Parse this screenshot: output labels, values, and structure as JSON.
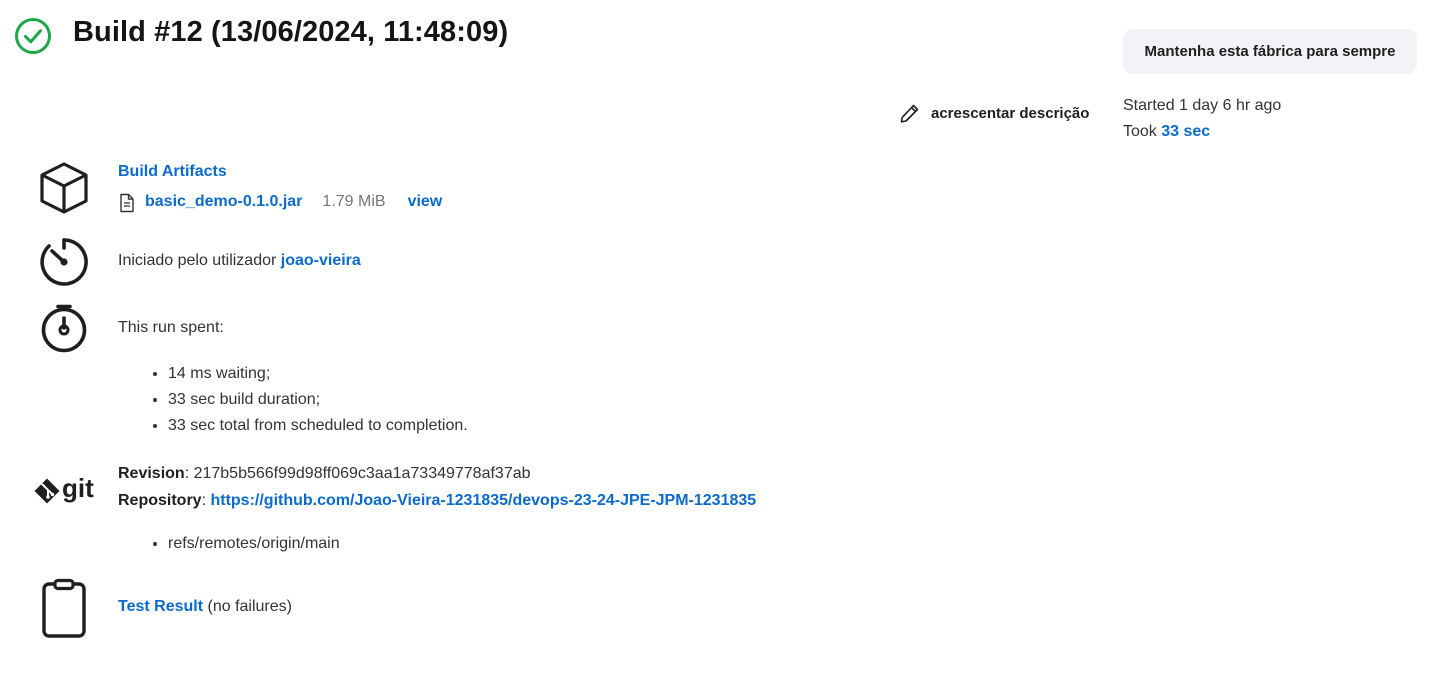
{
  "header": {
    "title": "Build #12 (13/06/2024, 11:48:09)",
    "keep_button": "Mantenha esta fábrica para sempre",
    "add_description": "acrescentar descrição"
  },
  "timing": {
    "started": "Started 1 day 6 hr ago",
    "took_label": "Took ",
    "took_value": "33 sec"
  },
  "artifacts": {
    "heading": "Build Artifacts",
    "items": [
      {
        "name": "basic_demo-0.1.0.jar",
        "size": "1.79 MiB",
        "view": "view"
      }
    ]
  },
  "cause": {
    "text": "Iniciado pelo utilizador ",
    "user": "joao-vieira"
  },
  "run_spent": {
    "heading": "This run spent:",
    "items": [
      "14 ms waiting;",
      "33 sec build duration;",
      "33 sec total from scheduled to completion."
    ]
  },
  "git": {
    "logo_text": "git",
    "revision_label": "Revision",
    "revision_value": ": 217b5b566f99d98ff069c3aa1a73349778af37ab",
    "repository_label": "Repository",
    "repository_sep": ": ",
    "repository_url": "https://github.com/Joao-Vieira-1231835/devops-23-24-JPE-JPM-1231835",
    "branches": [
      "refs/remotes/origin/main"
    ]
  },
  "tests": {
    "link": "Test Result",
    "status": " (no failures)"
  },
  "colors": {
    "success": "#1ea64b",
    "link": "#0b6bcb",
    "button_bg": "#f2f2f7"
  },
  "icons": [
    "check-circle-icon",
    "pencil-icon",
    "cube-icon",
    "file-icon",
    "timer-icon",
    "stopwatch-icon",
    "git-logo-icon",
    "clipboard-icon"
  ]
}
